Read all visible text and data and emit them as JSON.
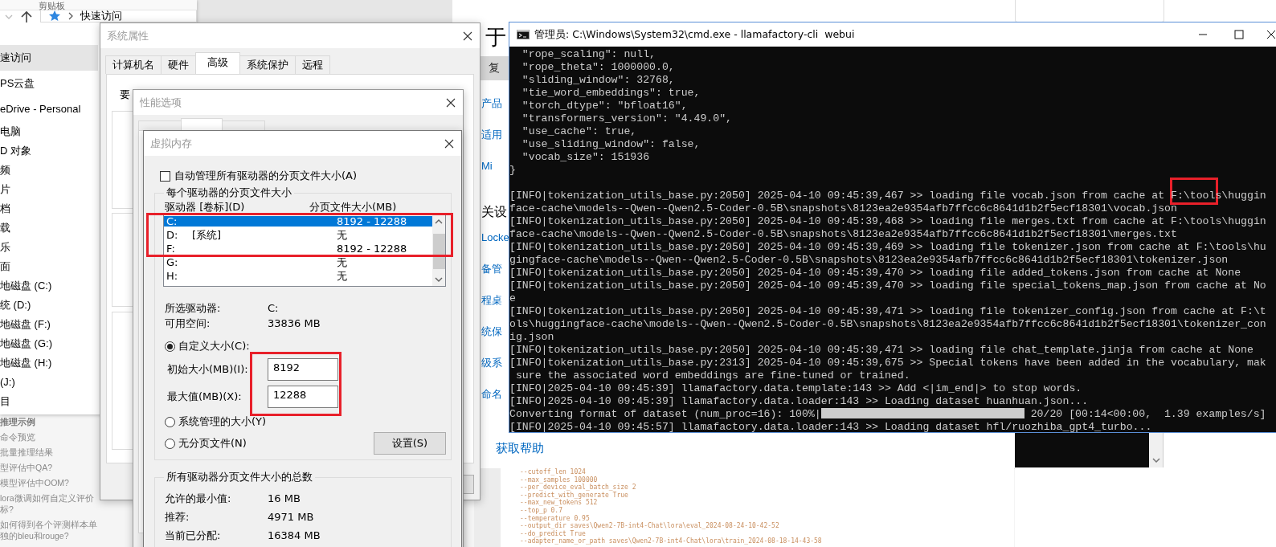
{
  "explorer": {
    "ribbon_group": "剪贴板",
    "address": "快速访问",
    "nav_items": [
      {
        "label": "速访问",
        "selected": true
      },
      {
        "label": "PS云盘",
        "selected": false
      },
      {
        "label": "eDrive - Personal",
        "selected": false
      },
      {
        "label": "电脑",
        "selected": false
      },
      {
        "label": "D 对象",
        "selected": false
      },
      {
        "label": "频",
        "selected": false
      },
      {
        "label": "片",
        "selected": false
      },
      {
        "label": "档",
        "selected": false
      },
      {
        "label": "载",
        "selected": false
      },
      {
        "label": "乐",
        "selected": false
      },
      {
        "label": "面",
        "selected": false
      },
      {
        "label": "地磁盘 (C:)",
        "selected": false
      },
      {
        "label": "统 (D:)",
        "selected": false
      },
      {
        "label": "地磁盘 (F:)",
        "selected": false
      },
      {
        "label": "地磁盘 (G:)",
        "selected": false
      },
      {
        "label": "地磁盘 (H:)",
        "selected": false
      },
      {
        "label": "(J:)",
        "selected": false
      },
      {
        "label": "目",
        "selected": false
      }
    ]
  },
  "help_page": {
    "items": [
      {
        "kind": "heading",
        "lines": [
          "推理示例"
        ]
      },
      {
        "kind": "link",
        "lines": [
          "命令预览"
        ]
      },
      {
        "kind": "link",
        "lines": [
          "批量推理结果"
        ]
      },
      {
        "kind": "link",
        "lines": [
          "型评估中QA?"
        ]
      },
      {
        "kind": "link",
        "lines": [
          "模型评估中OOM?"
        ]
      },
      {
        "kind": "link",
        "lines": [
          "lora微调如何自定义评价",
          "标?"
        ]
      },
      {
        "kind": "link",
        "lines": [
          "如何得到各个评测样本单",
          "独的bleu和rouge?"
        ]
      }
    ]
  },
  "settings_page": {
    "heading": "于",
    "copy_button": "复",
    "items": [
      {
        "kind": "link",
        "text": "产品"
      },
      {
        "kind": "link",
        "text": "适用"
      },
      {
        "kind": "link",
        "text": "Mi"
      },
      {
        "kind": "heading",
        "text": "关设"
      },
      {
        "kind": "link",
        "text": "Locke"
      },
      {
        "kind": "link",
        "text": "备管"
      },
      {
        "kind": "link",
        "text": "程桌"
      },
      {
        "kind": "link",
        "text": "统保"
      },
      {
        "kind": "link",
        "text": "级系"
      },
      {
        "kind": "link",
        "text": "命名"
      }
    ],
    "help_link": "获取帮助"
  },
  "code_page": {
    "lines": [
      "--cutoff_len 1024",
      "--max_samples 100000",
      "--per_device_eval_batch_size 2",
      "--predict_with_generate True",
      "--max_new_tokens 512",
      "--top_p 0.7",
      "--temperature 0.95",
      "--output_dir saves\\Qwen2-7B-int4-Chat\\lora\\eval_2024-08-24-10-42-52",
      "--do_predict True",
      "--adapter_name_or_path saves\\Qwen2-7B-int4-Chat\\lora\\train_2024-08-18-14-43-58"
    ]
  },
  "system_properties": {
    "title": "系统属性",
    "tabs": [
      {
        "label": "计算机名",
        "selected": false
      },
      {
        "label": "硬件",
        "selected": false
      },
      {
        "label": "高级",
        "selected": true
      },
      {
        "label": "系统保护",
        "selected": false
      },
      {
        "label": "远程",
        "selected": false
      }
    ],
    "content_fragment": "要"
  },
  "performance_options": {
    "title": "性能选项",
    "tabs": [
      {
        "selected": false
      },
      {
        "selected": true
      },
      {
        "selected": false
      }
    ]
  },
  "virtual_memory": {
    "title": "虚拟内存",
    "auto_manage": {
      "label": "自动管理所有驱动器的分页文件大小(A)",
      "checked": false
    },
    "group_title": "每个驱动器的分页文件大小",
    "columns": [
      "驱动器 [卷标](D)",
      "分页文件大小(MB)"
    ],
    "drives": [
      {
        "drive": "C:",
        "size": "8192 - 12288",
        "selected": true
      },
      {
        "drive": "D:",
        "label": "[系统]",
        "size": "无",
        "selected": false
      },
      {
        "drive": "F:",
        "size": "8192 - 12288",
        "selected": false
      },
      {
        "drive": "G:",
        "size": "无",
        "selected": false
      },
      {
        "drive": "H:",
        "size": "无",
        "selected": false
      }
    ],
    "info": [
      {
        "label": "所选驱动器:",
        "value": "C:"
      },
      {
        "label": "可用空间:",
        "value": "33836 MB"
      }
    ],
    "size_options": [
      {
        "label": "自定义大小(C):",
        "selected": true
      },
      {
        "label": "系统管理的大小(Y)",
        "selected": false
      },
      {
        "label": "无分页文件(N)",
        "selected": false
      }
    ],
    "size_fields": [
      {
        "label": "初始大小(MB)(I):",
        "value": "8192"
      },
      {
        "label": "最大值(MB)(X):",
        "value": "12288"
      }
    ],
    "set_button": "设置(S)",
    "totals_title": "所有驱动器分页文件大小的总数",
    "totals": [
      {
        "label": "允许的最小值:",
        "value": "16 MB"
      },
      {
        "label": "推荐:",
        "value": "4971 MB"
      },
      {
        "label": "当前已分配:",
        "value": "16384 MB"
      }
    ]
  },
  "console": {
    "title": "管理员: C:\\Windows\\System32\\cmd.exe - llamafactory-cli  webui",
    "lines": [
      {
        "kind": "text",
        "text": "  \"rope_scaling\": null,"
      },
      {
        "kind": "text",
        "text": "  \"rope_theta\": 1000000.0,"
      },
      {
        "kind": "text",
        "text": "  \"sliding_window\": 32768,"
      },
      {
        "kind": "text",
        "text": "  \"tie_word_embeddings\": true,"
      },
      {
        "kind": "text",
        "text": "  \"torch_dtype\": \"bfloat16\","
      },
      {
        "kind": "text",
        "text": "  \"transformers_version\": \"4.49.0\","
      },
      {
        "kind": "text",
        "text": "  \"use_cache\": true,"
      },
      {
        "kind": "text",
        "text": "  \"use_sliding_window\": false,"
      },
      {
        "kind": "text",
        "text": "  \"vocab_size\": 151936"
      },
      {
        "kind": "text",
        "text": "}"
      },
      {
        "kind": "blank"
      },
      {
        "kind": "text",
        "text": "[INFO|tokenization_utils_base.py:2050] 2025-04-10 09:45:39,467 >> loading file vocab.json from cache at F:\\tools\\huggin"
      },
      {
        "kind": "text",
        "text": "face-cache\\models--Qwen--Qwen2.5-Coder-0.5B\\snapshots\\8123ea2e9354afb7ffcc6c8641d1b2f5ecf18301\\vocab.json"
      },
      {
        "kind": "text",
        "text": "[INFO|tokenization_utils_base.py:2050] 2025-04-10 09:45:39,468 >> loading file merges.txt from cache at F:\\tools\\huggin"
      },
      {
        "kind": "text",
        "text": "face-cache\\models--Qwen--Qwen2.5-Coder-0.5B\\snapshots\\8123ea2e9354afb7ffcc6c8641d1b2f5ecf18301\\merges.txt"
      },
      {
        "kind": "text",
        "text": "[INFO|tokenization_utils_base.py:2050] 2025-04-10 09:45:39,469 >> loading file tokenizer.json from cache at F:\\tools\\hu"
      },
      {
        "kind": "text",
        "text": "gingface-cache\\models--Qwen--Qwen2.5-Coder-0.5B\\snapshots\\8123ea2e9354afb7ffcc6c8641d1b2f5ecf18301\\tokenizer.json"
      },
      {
        "kind": "text",
        "text": "[INFO|tokenization_utils_base.py:2050] 2025-04-10 09:45:39,470 >> loading file added_tokens.json from cache at None"
      },
      {
        "kind": "text",
        "text": "[INFO|tokenization_utils_base.py:2050] 2025-04-10 09:45:39,470 >> loading file special_tokens_map.json from cache at No"
      },
      {
        "kind": "text",
        "text": "e"
      },
      {
        "kind": "text",
        "text": "[INFO|tokenization_utils_base.py:2050] 2025-04-10 09:45:39,471 >> loading file tokenizer_config.json from cache at F:\\t"
      },
      {
        "kind": "text",
        "text": "ols\\huggingface-cache\\models--Qwen--Qwen2.5-Coder-0.5B\\snapshots\\8123ea2e9354afb7ffcc6c8641d1b2f5ecf18301\\tokenizer_con"
      },
      {
        "kind": "text",
        "text": "ig.json"
      },
      {
        "kind": "text",
        "text": "[INFO|tokenization_utils_base.py:2050] 2025-04-10 09:45:39,471 >> loading file chat_template.jinja from cache at None"
      },
      {
        "kind": "text",
        "text": "[INFO|tokenization_utils_base.py:2313] 2025-04-10 09:45:39,675 >> Special tokens have been added in the vocabulary, mak"
      },
      {
        "kind": "text",
        "text": " sure the associated word embeddings are fine-tuned or trained."
      },
      {
        "kind": "text",
        "text": "[INFO|2025-04-10 09:45:39] llamafactory.data.template:143 >> Add <|im_end|> to stop words."
      },
      {
        "kind": "text",
        "text": "[INFO|2025-04-10 09:45:39] llamafactory.data.loader:143 >> Loading dataset huanhuan.json..."
      },
      {
        "kind": "progress",
        "prefix": "Converting format of dataset (num_proc=16): 100%|",
        "level": 1,
        "suffix": " 20/20 [00:14<00:00,  1.39 examples/s]"
      },
      {
        "kind": "text",
        "text": "[INFO|2025-04-10 09:45:57] llamafactory.data.loader:143 >> Loading dataset hfl/ruozhiba_gpt4_turbo..."
      }
    ]
  }
}
